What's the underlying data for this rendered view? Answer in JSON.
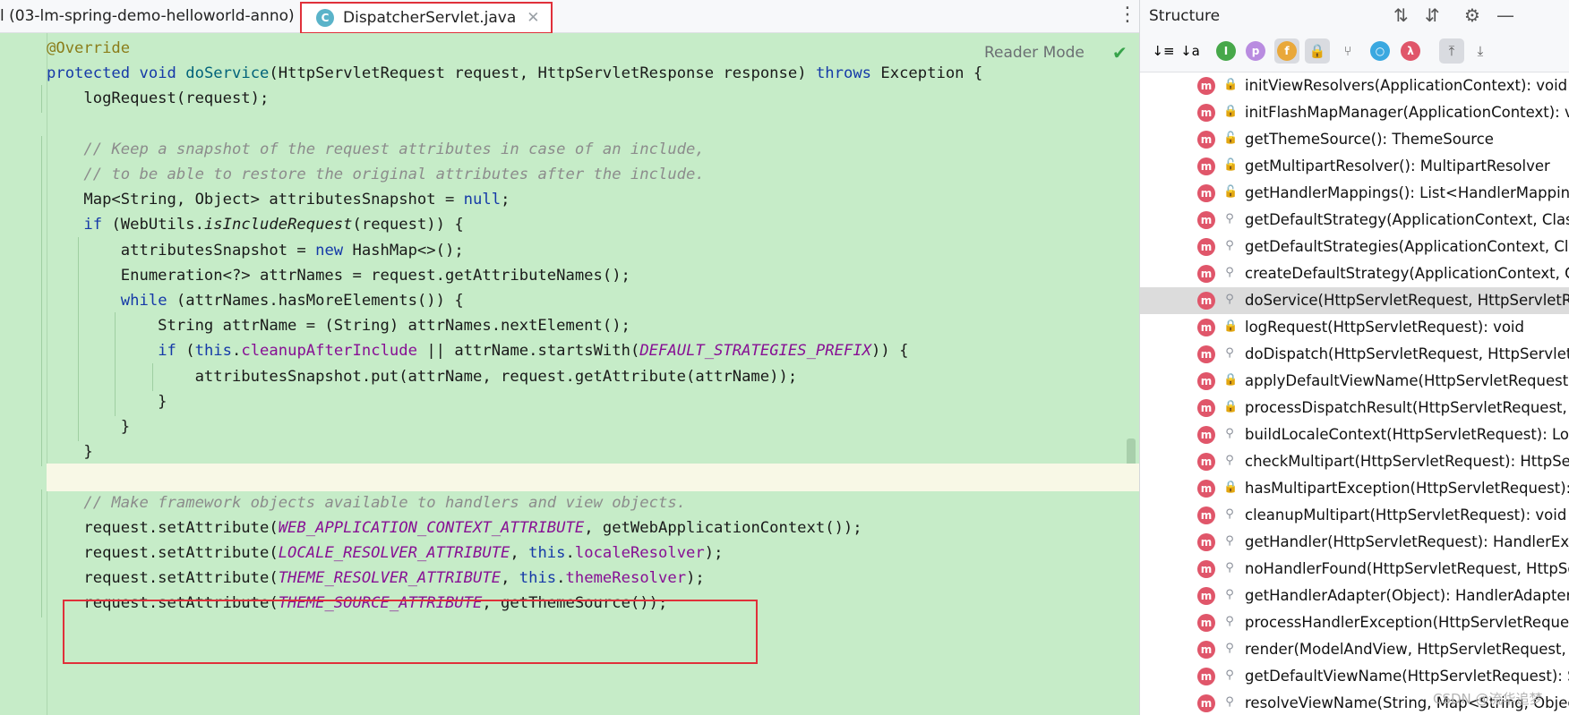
{
  "tabs": [
    {
      "label": "l (03-lm-spring-demo-helloworld-anno)",
      "active": false
    },
    {
      "label": "DispatcherServlet.java",
      "active": true
    }
  ],
  "editor": {
    "reader_mode": "Reader Mode",
    "icons": {
      "file": "class-c-icon",
      "close": "close-icon",
      "check": "check-icon",
      "more": "kebab-menu-icon"
    },
    "lines": [
      "@Override",
      "protected void doService(HttpServletRequest request, HttpServletResponse response) throws Exception {",
      "    logRequest(request);",
      "",
      "    // Keep a snapshot of the request attributes in case of an include,",
      "    // to be able to restore the original attributes after the include.",
      "    Map<String, Object> attributesSnapshot = null;",
      "    if (WebUtils.isIncludeRequest(request)) {",
      "        attributesSnapshot = new HashMap<>();",
      "        Enumeration<?> attrNames = request.getAttributeNames();",
      "        while (attrNames.hasMoreElements()) {",
      "            String attrName = (String) attrNames.nextElement();",
      "            if (this.cleanupAfterInclude || attrName.startsWith(DEFAULT_STRATEGIES_PREFIX)) {",
      "                attributesSnapshot.put(attrName, request.getAttribute(attrName));",
      "            }",
      "        }",
      "    }",
      "",
      "    // Make framework objects available to handlers and view objects.",
      "    request.setAttribute(WEB_APPLICATION_CONTEXT_ATTRIBUTE, getWebApplicationContext());",
      "    request.setAttribute(LOCALE_RESOLVER_ATTRIBUTE, this.localeResolver);",
      "    request.setAttribute(THEME_RESOLVER_ATTRIBUTE, this.themeResolver);",
      "    request.setAttribute(THEME_SOURCE_ATTRIBUTE, getThemeSource());"
    ]
  },
  "structure": {
    "title": "Structure",
    "members": [
      {
        "label": "initViewResolvers(ApplicationContext): void",
        "visibility": "private"
      },
      {
        "label": "initFlashMapManager(ApplicationContext): void",
        "visibility": "private"
      },
      {
        "label": "getThemeSource(): ThemeSource",
        "visibility": "public"
      },
      {
        "label": "getMultipartResolver(): MultipartResolver",
        "visibility": "public"
      },
      {
        "label": "getHandlerMappings(): List<HandlerMapping>",
        "visibility": "public"
      },
      {
        "label": "getDefaultStrategy(ApplicationContext, Class<T",
        "visibility": "protected"
      },
      {
        "label": "getDefaultStrategies(ApplicationContext, Class<",
        "visibility": "protected"
      },
      {
        "label": "createDefaultStrategy(ApplicationContext, Class",
        "visibility": "protected"
      },
      {
        "label": "doService(HttpServletRequest, HttpServletRespo",
        "visibility": "protected",
        "selected": true
      },
      {
        "label": "logRequest(HttpServletRequest): void",
        "visibility": "private"
      },
      {
        "label": "doDispatch(HttpServletRequest, HttpServletResp",
        "visibility": "protected"
      },
      {
        "label": "applyDefaultViewName(HttpServletRequest, Mo",
        "visibility": "private"
      },
      {
        "label": "processDispatchResult(HttpServletRequest, Http",
        "visibility": "private"
      },
      {
        "label": "buildLocaleContext(HttpServletRequest): LocaleC",
        "visibility": "protected"
      },
      {
        "label": "checkMultipart(HttpServletRequest): HttpServlet",
        "visibility": "protected"
      },
      {
        "label": "hasMultipartException(HttpServletRequest): boo",
        "visibility": "private"
      },
      {
        "label": "cleanupMultipart(HttpServletRequest): void",
        "visibility": "protected"
      },
      {
        "label": "getHandler(HttpServletRequest): HandlerExecuti",
        "visibility": "protected"
      },
      {
        "label": "noHandlerFound(HttpServletRequest, HttpServle",
        "visibility": "protected"
      },
      {
        "label": "getHandlerAdapter(Object): HandlerAdapter",
        "visibility": "protected"
      },
      {
        "label": "processHandlerException(HttpServletRequest, H",
        "visibility": "protected"
      },
      {
        "label": "render(ModelAndView, HttpServletRequest, Htt",
        "visibility": "protected"
      },
      {
        "label": "getDefaultViewName(HttpServletRequest): Strin",
        "visibility": "protected"
      },
      {
        "label": "resolveViewName(String, Map<String, Object>, L",
        "visibility": "protected"
      }
    ]
  },
  "watermark": "CSDN @流华追梦",
  "colors": {
    "highlight": "#e0303a",
    "editor_bg": "#c6ecc8",
    "method_icon": "#e0566a"
  }
}
